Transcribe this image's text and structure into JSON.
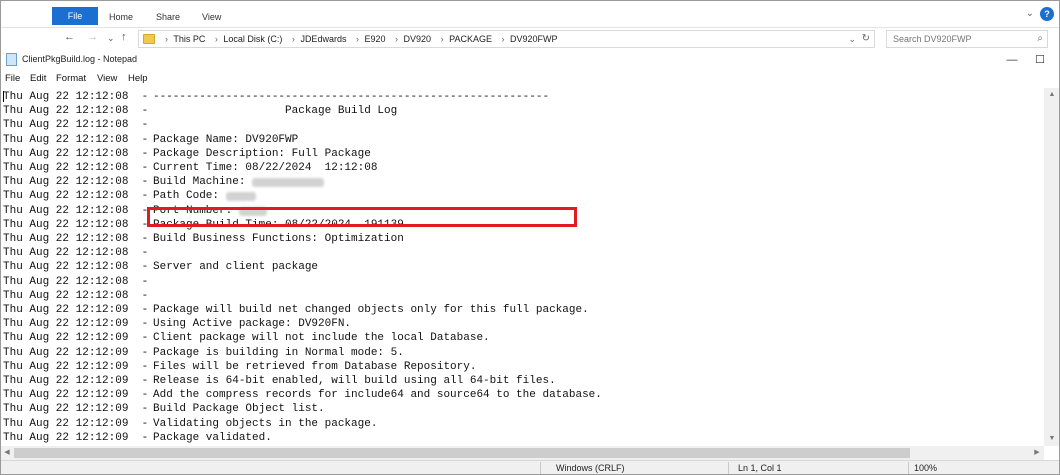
{
  "explorer": {
    "tabs": [
      "File",
      "Home",
      "Share",
      "View"
    ],
    "breadcrumb": [
      "This PC",
      "Local Disk (C:)",
      "JDEdwards",
      "E920",
      "DV920",
      "PACKAGE",
      "DV920FWP"
    ],
    "search_placeholder": "Search DV920FWP",
    "help_glyph": "?"
  },
  "notepad": {
    "title": "ClientPkgBuild.log - Notepad",
    "menu": [
      "File",
      "Edit",
      "Format",
      "View",
      "Help"
    ]
  },
  "log": [
    {
      "ts": "Thu Aug 22 12:12:08  -",
      "msg": "------------------------------------------------------------"
    },
    {
      "ts": "Thu Aug 22 12:12:08  -",
      "msg": "                    Package Build Log"
    },
    {
      "ts": "Thu Aug 22 12:12:08  -",
      "msg": ""
    },
    {
      "ts": "Thu Aug 22 12:12:08  -",
      "msg": "Package Name: DV920FWP"
    },
    {
      "ts": "Thu Aug 22 12:12:08  -",
      "msg": "Package Description: Full Package"
    },
    {
      "ts": "Thu Aug 22 12:12:08  -",
      "msg": "Current Time: 08/22/2024  12:12:08"
    },
    {
      "ts": "Thu Aug 22 12:12:08  -",
      "msg": "Build Machine: "
    },
    {
      "ts": "Thu Aug 22 12:12:08  -",
      "msg": "Path Code: "
    },
    {
      "ts": "Thu Aug 22 12:12:08  -",
      "msg": "Port Number: "
    },
    {
      "ts": "Thu Aug 22 12:12:08  -",
      "msg": "Package Build Time: 08/22/2024  191139"
    },
    {
      "ts": "Thu Aug 22 12:12:08  -",
      "msg": "Build Business Functions: Optimization"
    },
    {
      "ts": "Thu Aug 22 12:12:08  -",
      "msg": ""
    },
    {
      "ts": "Thu Aug 22 12:12:08  -",
      "msg": "Server and client package"
    },
    {
      "ts": "Thu Aug 22 12:12:08  -",
      "msg": ""
    },
    {
      "ts": "Thu Aug 22 12:12:08  -",
      "msg": ""
    },
    {
      "ts": "Thu Aug 22 12:12:09  -",
      "msg": "Package will build net changed objects only for this full package."
    },
    {
      "ts": "Thu Aug 22 12:12:09  -",
      "msg": "Using Active package: DV920FN."
    },
    {
      "ts": "Thu Aug 22 12:12:09  -",
      "msg": "Client package will not include the local Database."
    },
    {
      "ts": "Thu Aug 22 12:12:09  -",
      "msg": "Package is building in Normal mode: 5."
    },
    {
      "ts": "Thu Aug 22 12:12:09  -",
      "msg": "Files will be retrieved from Database Repository."
    },
    {
      "ts": "Thu Aug 22 12:12:09  -",
      "msg": "Release is 64-bit enabled, will build using all 64-bit files."
    },
    {
      "ts": "Thu Aug 22 12:12:09  -",
      "msg": "Add the compress records for include64 and source64 to the database."
    },
    {
      "ts": "Thu Aug 22 12:12:09  -",
      "msg": "Build Package Object list."
    },
    {
      "ts": "Thu Aug 22 12:12:09  -",
      "msg": "Validating objects in the package."
    },
    {
      "ts": "Thu Aug 22 12:12:09  -",
      "msg": "Package validated."
    }
  ],
  "status": {
    "encoding": "Windows (CRLF)",
    "position": "Ln 1, Col 1",
    "zoom": "100%"
  },
  "colors": {
    "accent": "#1a6fd1",
    "highlight": "#e01b24"
  }
}
